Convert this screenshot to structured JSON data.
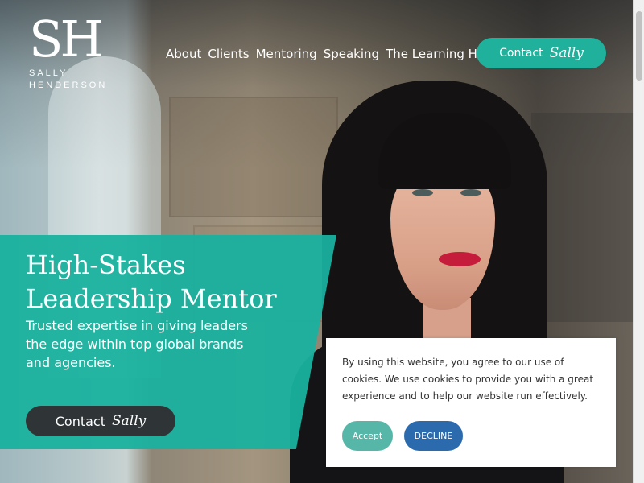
{
  "header": {
    "logo_mark": "SH",
    "logo_name_line1": "SALLY",
    "logo_name_line2": "HENDERSON",
    "nav": [
      "About",
      "Clients",
      "Mentoring",
      "Speaking",
      "The Learning Hub"
    ],
    "contact_label": "Contact",
    "contact_script": "Sally"
  },
  "hero": {
    "headline_line1": "High-Stakes",
    "headline_line2": "Leadership Mentor",
    "subtext": "Trusted expertise in giving leaders the edge within top global brands and agencies.",
    "cta_label": "Contact",
    "cta_script": "Sally"
  },
  "cookie": {
    "message": "By using this website, you agree to our use of cookies. We use cookies to provide you with a great experience and to help our website run effectively.",
    "accept_label": "Accept",
    "decline_label": "DECLINE"
  },
  "colors": {
    "teal": "#1fb19b",
    "dark_button": "#2f3537",
    "accept": "#56b6a8",
    "decline": "#2b6aad"
  }
}
